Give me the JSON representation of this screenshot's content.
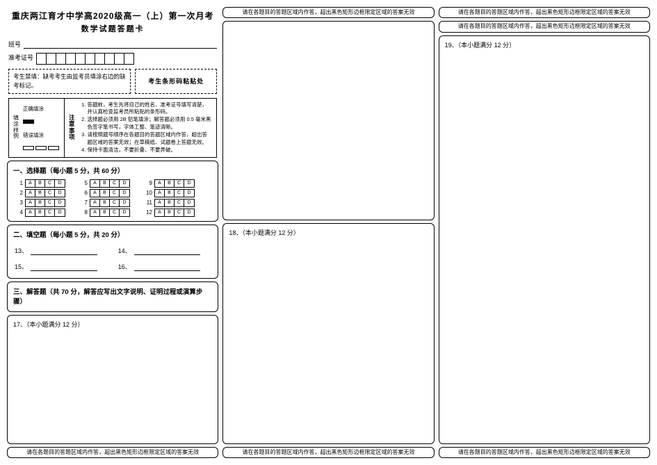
{
  "header": {
    "title": "重庆两江育才中学高2020级高一（上）第一次月考",
    "subtitle": "数学试题答题卡",
    "class_label": "班号",
    "ticket_label": "准考证号"
  },
  "examinee_notice": "考生禁填：缺考考生由监考员填涂右边的缺考标记。",
  "barcode_label": "考生条形码粘贴处",
  "fill_example": {
    "side_label": "填涂样例",
    "correct": "正确填涂",
    "wrong": "错误填涂"
  },
  "attention": {
    "side_label": "注意事项",
    "items": [
      "答题前，考生先将自己的姓名、准考证号填写清楚，并认真检查监考员所粘贴的条形码。",
      "选择题必须用 2B 铅笔填涂；解答题必须用 0.5 毫米黑色签字笔书写，字体工整、笔迹清晰。",
      "请按照题号顺序在各题目的答题区域内作答，超出答题区域的答案无效；在草稿纸、试题卷上答题无效。",
      "保持卡面清洁，不要折叠、不要弄破。"
    ]
  },
  "sections": {
    "choice_title": "一、选择题（每小题 5 分，共 60 分）",
    "fill_title": "二、填空题（每小题 5 分，共 20 分）",
    "answer_title": "三、解答题（共 70 分，解答应写出文字说明、证明过程或演算步骤）"
  },
  "choice": {
    "options": [
      "A",
      "B",
      "C",
      "D"
    ],
    "groups": [
      [
        1,
        2,
        3,
        4
      ],
      [
        5,
        6,
        7,
        8
      ],
      [
        9,
        10,
        11,
        12
      ]
    ]
  },
  "fill_blanks": [
    "13、",
    "14、",
    "15、",
    "16、"
  ],
  "questions": {
    "q17": "17、（本小题满分 12 分）",
    "q18": "18、（本小题满分 12 分）",
    "q19": "19、（本小题满分 12 分）"
  },
  "boundary_notice": "请在各题目的答题区域内作答，超出黑色矩形边框限定区域的答案无效"
}
